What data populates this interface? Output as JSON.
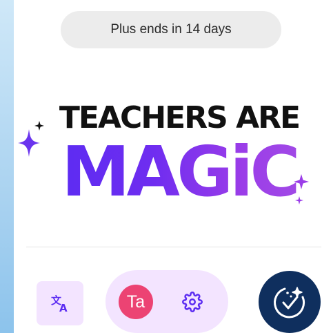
{
  "trial_banner": {
    "text": "Plus ends in 14 days"
  },
  "logo": {
    "line1": "TEACHERS ARE",
    "line2": "MAGiC"
  },
  "footer": {
    "translate_icon": "translate-icon",
    "avatar_initials": "Ta",
    "settings_icon": "gear-icon",
    "magic_icon": "sparkle-check-icon"
  },
  "colors": {
    "avatar_bg": "#ec4373",
    "accent_purple": "#6a34ee",
    "pill_bg": "#f3e4ff",
    "magic_button_bg": "#0f2f5e"
  }
}
